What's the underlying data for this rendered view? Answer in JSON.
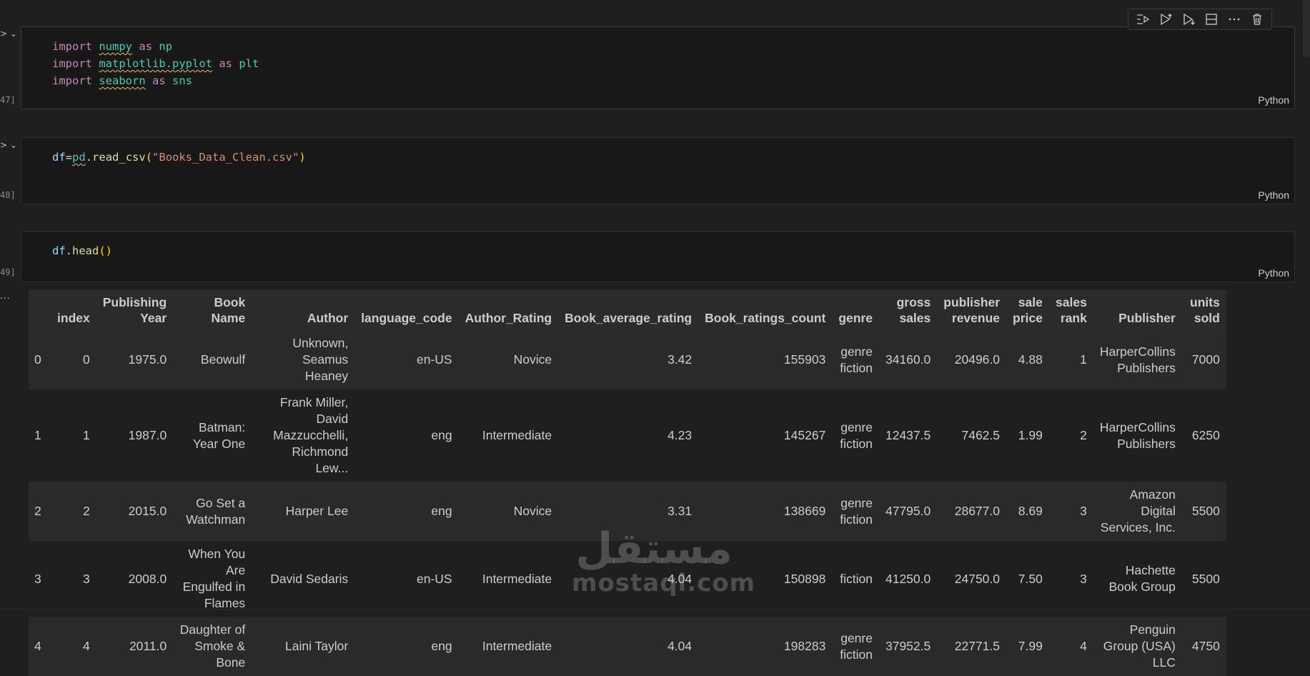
{
  "cells": [
    {
      "exec": "47]",
      "language": "Python",
      "lines": [
        [
          [
            "kw",
            "import"
          ],
          [
            "plain",
            " "
          ],
          [
            "mod sq",
            "numpy"
          ],
          [
            "plain",
            " "
          ],
          [
            "kw",
            "as"
          ],
          [
            "plain",
            " "
          ],
          [
            "mod",
            "np"
          ]
        ],
        [
          [
            "kw",
            "import"
          ],
          [
            "plain",
            " "
          ],
          [
            "mod sq",
            "matplotlib.pyplot"
          ],
          [
            "plain",
            " "
          ],
          [
            "kw",
            "as"
          ],
          [
            "plain",
            " "
          ],
          [
            "mod",
            "plt"
          ]
        ],
        [
          [
            "kw",
            "import"
          ],
          [
            "plain",
            " "
          ],
          [
            "mod sq",
            "seaborn"
          ],
          [
            "plain",
            " "
          ],
          [
            "kw",
            "as"
          ],
          [
            "plain",
            " "
          ],
          [
            "mod",
            "sns"
          ]
        ]
      ]
    },
    {
      "exec": "48]",
      "language": "Python",
      "lines": [
        [
          [
            "id",
            "df"
          ],
          [
            "plain",
            "="
          ],
          [
            "mod sq",
            "pd"
          ],
          [
            "plain",
            "."
          ],
          [
            "fn",
            "read_csv"
          ],
          [
            "paren",
            "("
          ],
          [
            "str",
            "\"Books_Data_Clean.csv\""
          ],
          [
            "paren",
            ")"
          ]
        ]
      ]
    },
    {
      "exec": "49]",
      "language": "Python",
      "lines": [
        [
          [
            "id",
            "df"
          ],
          [
            "plain",
            "."
          ],
          [
            "fn",
            "head"
          ],
          [
            "paren",
            "()"
          ]
        ]
      ]
    }
  ],
  "toolbar": {
    "icons": [
      "run-by-line-icon",
      "execute-above-icon",
      "execute-below-icon",
      "split-cell-icon",
      "more-icon",
      "delete-icon"
    ]
  },
  "output_marker": "...",
  "table": {
    "headers": [
      "",
      "index",
      "Publishing Year",
      "Book Name",
      "Author",
      "language_code",
      "Author_Rating",
      "Book_average_rating",
      "Book_ratings_count",
      "genre",
      "gross sales",
      "publisher revenue",
      "sale price",
      "sales rank",
      "Publisher",
      "units sold"
    ],
    "rows": [
      [
        "0",
        "0",
        "1975.0",
        "Beowulf",
        "Unknown, Seamus Heaney",
        "en-US",
        "Novice",
        "3.42",
        "155903",
        "genre fiction",
        "34160.0",
        "20496.0",
        "4.88",
        "1",
        "HarperCollins Publishers",
        "7000"
      ],
      [
        "1",
        "1",
        "1987.0",
        "Batman: Year One",
        "Frank Miller, David Mazzucchelli, Richmond Lew...",
        "eng",
        "Intermediate",
        "4.23",
        "145267",
        "genre fiction",
        "12437.5",
        "7462.5",
        "1.99",
        "2",
        "HarperCollins Publishers",
        "6250"
      ],
      [
        "2",
        "2",
        "2015.0",
        "Go Set a Watchman",
        "Harper Lee",
        "eng",
        "Novice",
        "3.31",
        "138669",
        "genre fiction",
        "47795.0",
        "28677.0",
        "8.69",
        "3",
        "Amazon Digital Services, Inc.",
        "5500"
      ],
      [
        "3",
        "3",
        "2008.0",
        "When You Are Engulfed in Flames",
        "David Sedaris",
        "en-US",
        "Intermediate",
        "4.04",
        "150898",
        "fiction",
        "41250.0",
        "24750.0",
        "7.50",
        "3",
        "Hachette Book Group",
        "5500"
      ],
      [
        "4",
        "4",
        "2011.0",
        "Daughter of Smoke & Bone",
        "Laini Taylor",
        "eng",
        "Intermediate",
        "4.04",
        "198283",
        "genre fiction",
        "37952.5",
        "22771.5",
        "7.99",
        "4",
        "Penguin Group (USA) LLC",
        "4750"
      ]
    ]
  },
  "watermark": {
    "arabic": "مستقل",
    "latin": "mostaql.com"
  }
}
